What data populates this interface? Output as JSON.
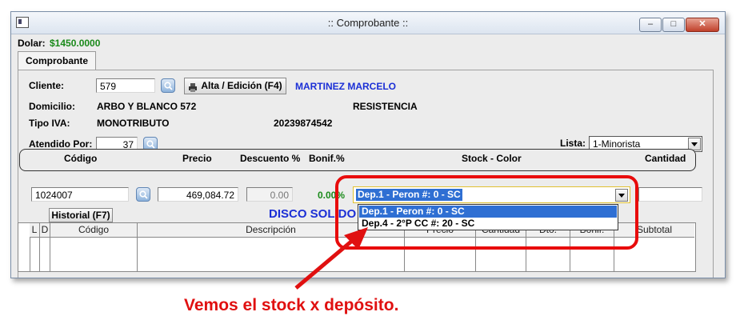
{
  "window": {
    "title": ":: Comprobante ::"
  },
  "dolar": {
    "label": "Dolar:",
    "value": "$1450.0000"
  },
  "tab": {
    "label": "Comprobante"
  },
  "cliente": {
    "label": "Cliente:",
    "value": "579",
    "alta_label": "Alta / Edición (F4)",
    "name": "MARTINEZ MARCELO"
  },
  "domicilio": {
    "label": "Domicilio:",
    "value": "ARBO Y BLANCO 572",
    "city": "RESISTENCIA"
  },
  "tipo_iva": {
    "label": "Tipo IVA:",
    "value": "MONOTRIBUTO",
    "cuit": "20239874542"
  },
  "atendido": {
    "label": "Atendido Por:",
    "value": "37"
  },
  "lista": {
    "label": "Lista:",
    "value": "1-Minorista"
  },
  "headers": {
    "codigo": "Código",
    "precio": "Precio",
    "descuento": "Descuento %",
    "bonif": "Bonif.%",
    "stock": "Stock - Color",
    "cantidad": "Cantidad"
  },
  "item": {
    "codigo": "1024007",
    "precio": "469,084.72",
    "descuento": "0.00",
    "bonif": "0.00%",
    "historial_label": "Historial (F7)",
    "description": "DISCO SOLIDO A"
  },
  "stock_select": {
    "selected": "Dep.1 - Peron #: 0 - SC",
    "options": [
      "Dep.1 - Peron #: 0 - SC",
      "Dep.4 - 2°P CC #: 20 - SC"
    ]
  },
  "grid_headers": [
    "L",
    "D",
    "Código",
    "Descripción",
    "Precio",
    "Cantidad",
    "Dto.",
    "Bonif.",
    "Subtotal"
  ],
  "annotation": "Vemos el stock x depósito.",
  "colors": {
    "annotation": "#e01010",
    "accent_blue": "#1b2fd6",
    "green": "#1a8a1a",
    "selection": "#2f6fd3"
  }
}
